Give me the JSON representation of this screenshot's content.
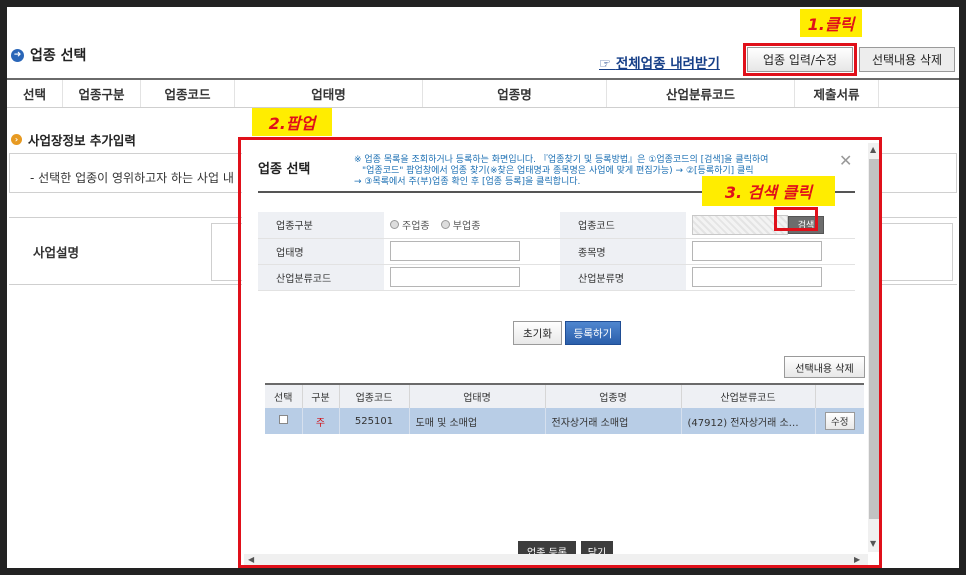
{
  "header": {
    "title": "업종 선택",
    "download_link": "전체업종 내려받기",
    "btn_input_edit": "업종 입력/수정",
    "btn_delete_selected": "선택내용 삭제"
  },
  "annotations": {
    "step1": "1.클릭",
    "step2": "2.팝업",
    "step3": "3. 검색 클릭"
  },
  "main_table": {
    "columns": [
      "선택",
      "업종구분",
      "업종코드",
      "업태명",
      "업종명",
      "산업분류코드",
      "제출서류"
    ]
  },
  "business_info": {
    "title": "사업장정보 추가입력",
    "note": "- 선택한 업종이 영위하고자 하는 사업 내",
    "desc_label": "사업설명"
  },
  "popup": {
    "title": "업종 선택",
    "notice": [
      "※ 업종 목록을 조회하거나 등록하는 화면입니다. 『업종찾기 및 등록방법』은 ①업종코드의 [검색]을 클릭하여",
      "\"업종코드\" 팝업창에서 업종 찾기(※찾은 업태명과 종목명은 사업에 맞게 편집가능) → ②[등록하기] 클릭",
      "→ ③목록에서 주(부)업종 확인 후 [업종 등록]을 클릭합니다."
    ],
    "close_symbol": "✕",
    "form": {
      "type_label": "업종구분",
      "type_main": "주업종",
      "type_sub": "부업종",
      "code_label": "업종코드",
      "search_btn": "검색",
      "biz_type_label": "업태명",
      "item_label": "종목명",
      "ind_code_label": "산업분류코드",
      "ind_name_label": "산업분류명"
    },
    "btn_reset": "초기화",
    "btn_register": "등록하기",
    "btn_delete_selected": "선택내용 삭제",
    "result_columns": [
      "선택",
      "구분",
      "업종코드",
      "업태명",
      "업종명",
      "산업분류코드",
      ""
    ],
    "result_row": {
      "kind": "주",
      "code": "525101",
      "biz_type": "도매 및 소매업",
      "item": "전자상거래 소매업",
      "ind_code": "(47912) 전자상거래 소…",
      "edit_btn": "수정"
    },
    "btn_register_industry": "업종 등록",
    "btn_close": "닫기"
  },
  "colors": {
    "highlight_red": "#e0101a",
    "callout_yellow": "#ffed00",
    "link_blue": "#163f88",
    "selected_row": "#b8cde6"
  }
}
